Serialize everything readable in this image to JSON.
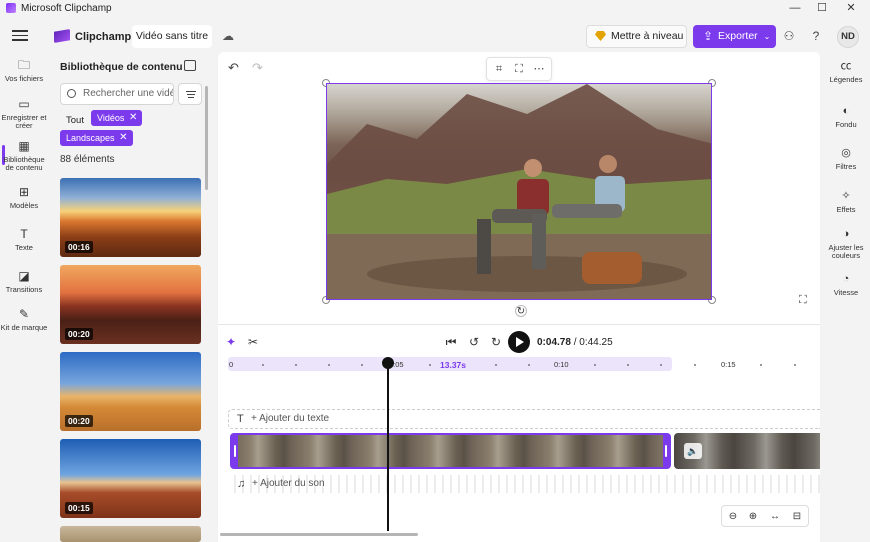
{
  "window": {
    "title": "Microsoft Clipchamp",
    "controls": [
      "—",
      "☐",
      "✕"
    ]
  },
  "header": {
    "brand": "Clipchamp",
    "project_title": "Vidéo sans titre",
    "upgrade_label": "Mettre à niveau",
    "export_label": "Exporter",
    "avatar_initials": "ND"
  },
  "left_nav": [
    {
      "label": "Vos fichiers",
      "icon": "folder-icon"
    },
    {
      "label": "Enregistrer et créer",
      "icon": "camera-icon"
    },
    {
      "label": "Bibliothèque de contenu",
      "icon": "library-icon",
      "active": true
    },
    {
      "label": "Modèles",
      "icon": "templates-icon"
    },
    {
      "label": "Texte",
      "icon": "text-icon"
    },
    {
      "label": "Transitions",
      "icon": "transitions-icon"
    },
    {
      "label": "Kit de marque",
      "icon": "brand-kit-icon"
    }
  ],
  "library": {
    "title": "Bibliothèque de contenu",
    "search_placeholder": "Rechercher une vidéo",
    "filter_all": "Tout",
    "chips": [
      "Vidéos",
      "Landscapes"
    ],
    "count": "88 éléments",
    "thumbnails": [
      {
        "duration": "00:16"
      },
      {
        "duration": "00:20"
      },
      {
        "duration": "00:20"
      },
      {
        "duration": "00:15"
      }
    ]
  },
  "timeline": {
    "current_time": "0:04.78",
    "total_time": "/ 0:44.25",
    "ticks": [
      "0",
      "0:05",
      "0:10",
      "0:15"
    ],
    "selection_length": "13.37s",
    "add_text": "+ Ajouter du texte",
    "add_audio": "+ Ajouter du son"
  },
  "right_panel": [
    {
      "label": "Légendes",
      "icon": "captions-icon"
    },
    {
      "label": "Fondu",
      "icon": "fade-icon"
    },
    {
      "label": "Filtres",
      "icon": "filters-icon"
    },
    {
      "label": "Effets",
      "icon": "effects-icon"
    },
    {
      "label": "Ajuster les couleurs",
      "icon": "adjust-colors-icon"
    },
    {
      "label": "Vitesse",
      "icon": "speed-icon"
    }
  ],
  "colors": {
    "accent": "#7c3aed",
    "chip_bg": "#7c3aed",
    "ruler_bg": "#ece4fb"
  }
}
